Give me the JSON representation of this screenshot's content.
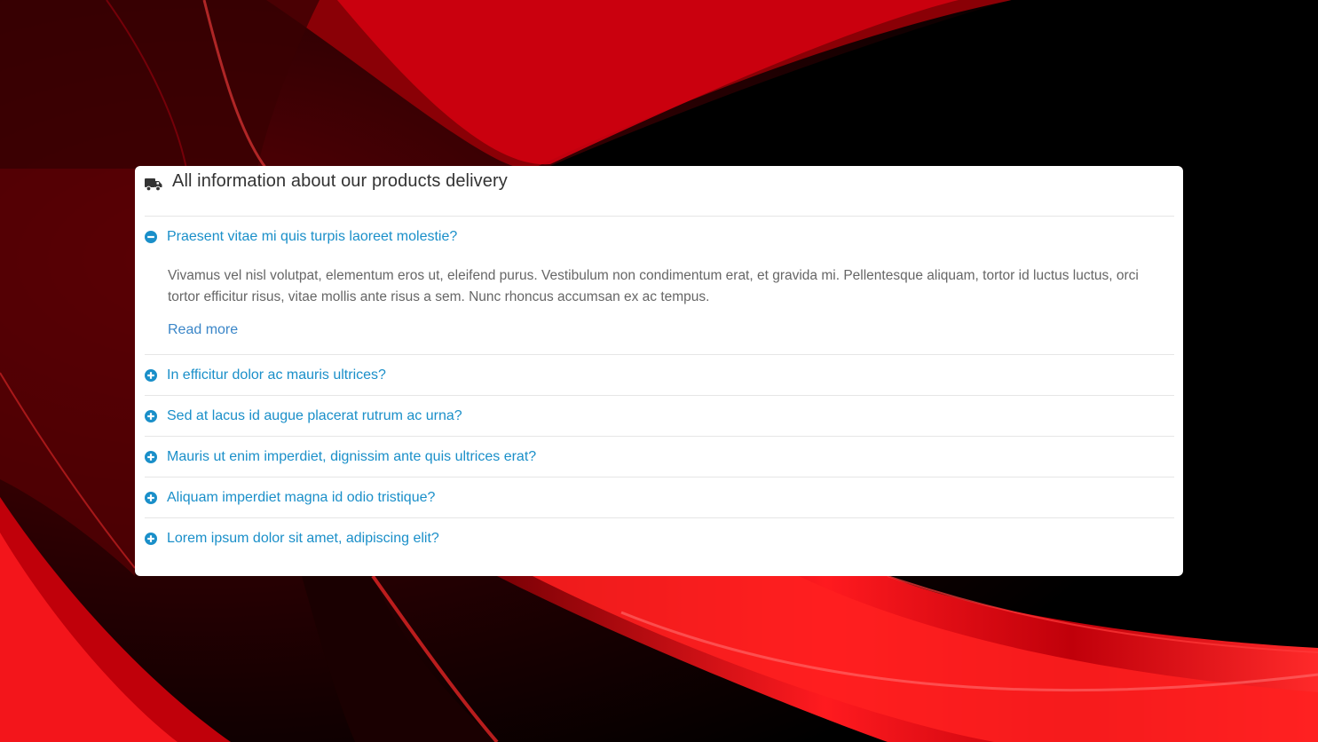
{
  "colors": {
    "accent": "#1a8fc9",
    "link": "#3a86c8",
    "text_muted": "#666666",
    "title": "#333333",
    "background_red": "#e0000b",
    "background_dark": "#000000"
  },
  "panel": {
    "title": "All information about our products delivery",
    "title_icon": "truck-icon"
  },
  "faq": {
    "items": [
      {
        "question": "Praesent vitae mi quis turpis laoreet molestie?",
        "expanded": true,
        "icon": "minus-circle-icon",
        "answer": "Vivamus vel nisl volutpat, elementum eros ut, eleifend purus. Vestibulum non condimentum erat, et gravida mi. Pellentesque aliquam, tortor id luctus luctus, orci tortor efficitur risus, vitae mollis ante risus a sem. Nunc rhoncus accumsan ex ac tempus.",
        "read_more": "Read more"
      },
      {
        "question": "In efficitur dolor ac mauris ultrices?",
        "expanded": false,
        "icon": "plus-circle-icon"
      },
      {
        "question": "Sed at lacus id augue placerat rutrum ac urna?",
        "expanded": false,
        "icon": "plus-circle-icon"
      },
      {
        "question": "Mauris ut enim imperdiet, dignissim ante quis ultrices erat?",
        "expanded": false,
        "icon": "plus-circle-icon"
      },
      {
        "question": "Aliquam imperdiet magna id odio tristique?",
        "expanded": false,
        "icon": "plus-circle-icon"
      },
      {
        "question": "Lorem ipsum dolor sit amet, adipiscing elit?",
        "expanded": false,
        "icon": "plus-circle-icon"
      }
    ]
  }
}
